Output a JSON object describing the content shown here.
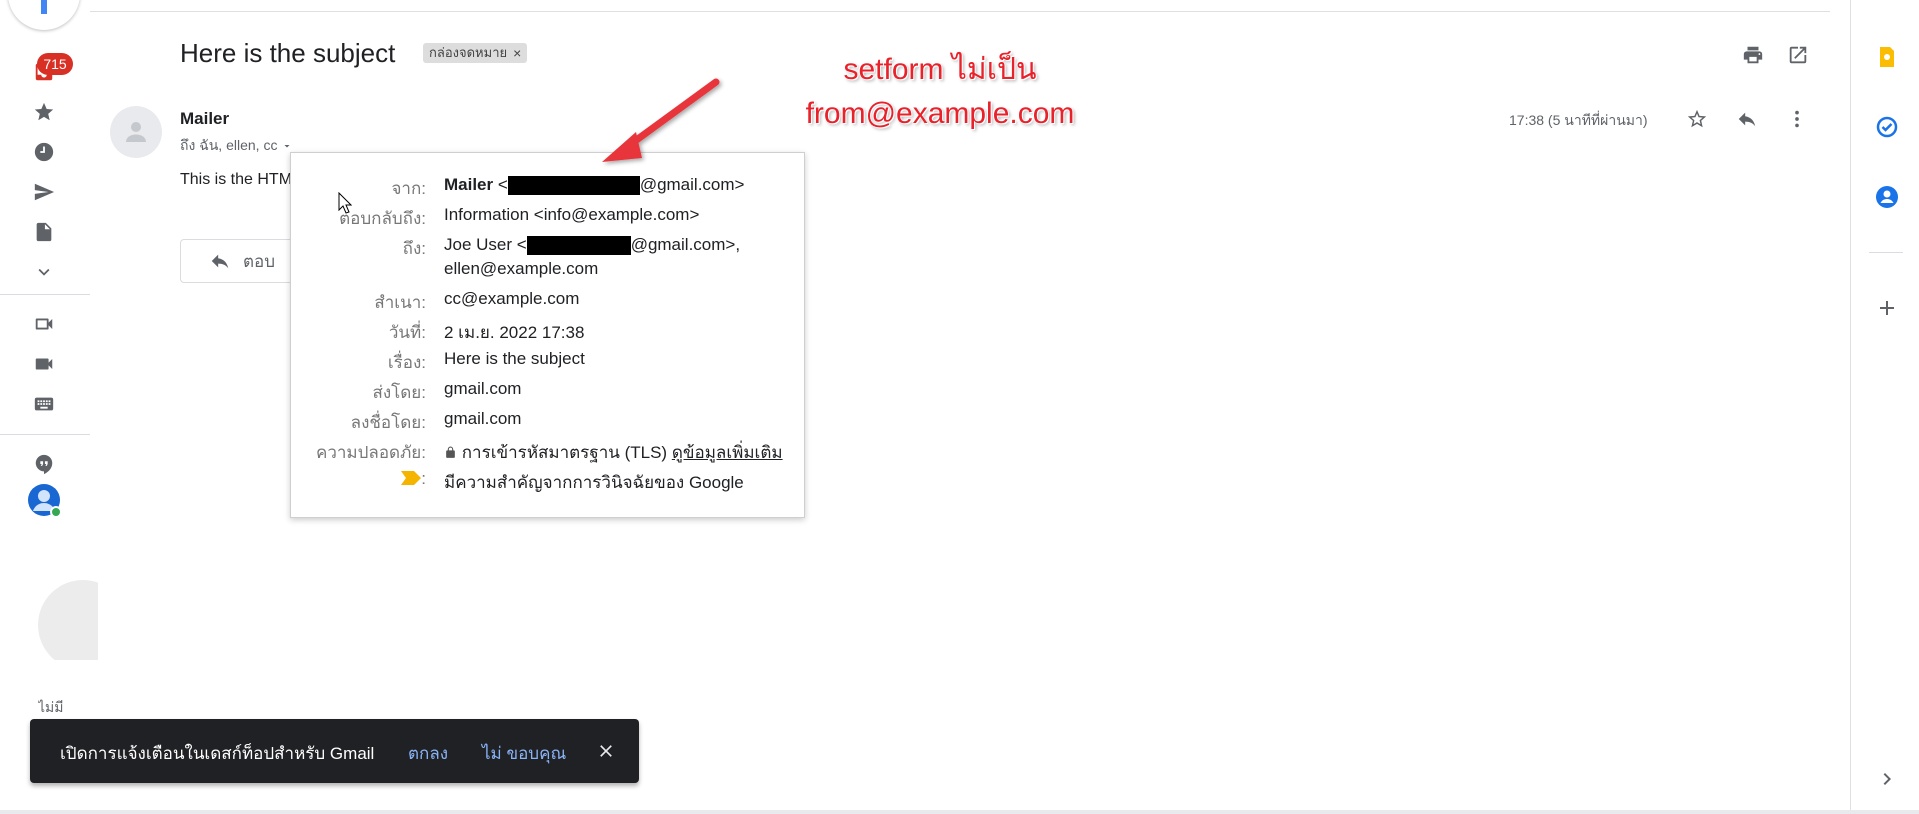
{
  "rail": {
    "unread_badge": "715",
    "clipped_text": "ไม่มี"
  },
  "header": {
    "subject": "Here is the subject",
    "label_chip": "กล่องจดหมาย",
    "label_chip_close": "×"
  },
  "message": {
    "sender": "Mailer",
    "recipients": "ถึง ฉัน, ellen, cc",
    "time": "17:38 (5 นาทีที่ผ่านมา)",
    "body_preview": "This is the HTM",
    "reply_label": "ตอบ"
  },
  "details": {
    "from_label": "จาก:",
    "from_name": "Mailer",
    "from_open": "<",
    "from_domain": "@gmail.com>",
    "replyto_label": "ตอบกลับถึง:",
    "replyto_value": "Information <info@example.com>",
    "to_label": "ถึง:",
    "to_name": "Joe User <",
    "to_domain": "@gmail.com>,",
    "to_second": "ellen@example.com",
    "cc_label": "สำเนา:",
    "cc_value": "cc@example.com",
    "date_label": "วันที่:",
    "date_value": "2 เม.ย. 2022 17:38",
    "subject_label": "เรื่อง:",
    "subject_value": "Here is the subject",
    "mailedby_label": "ส่งโดย:",
    "mailedby_value": "gmail.com",
    "signedby_label": "ลงชื่อโดย:",
    "signedby_value": "gmail.com",
    "security_label": "ความปลอดภัย:",
    "security_value": "การเข้ารหัสมาตรฐาน (TLS)",
    "security_link": "ดูข้อมูลเพิ่มเติม",
    "importance_label": ":",
    "importance_value": "มีความสำคัญจากการวินิจฉัยของ Google"
  },
  "annotation": {
    "line1": "setform ไม่เป็น",
    "line2": "from@example.com"
  },
  "snackbar": {
    "text": "เปิดการแจ้งเตือนในเดสก์ท็อปสำหรับ Gmail",
    "ok": "ตกลง",
    "no": "ไม่ ขอบคุณ"
  },
  "colors": {
    "annotation_red": "#e8212a",
    "badge_red": "#d93025",
    "snackbar_bg": "#202124",
    "snackbar_link": "#8ab4f8",
    "importance_yellow": "#f4b400"
  }
}
